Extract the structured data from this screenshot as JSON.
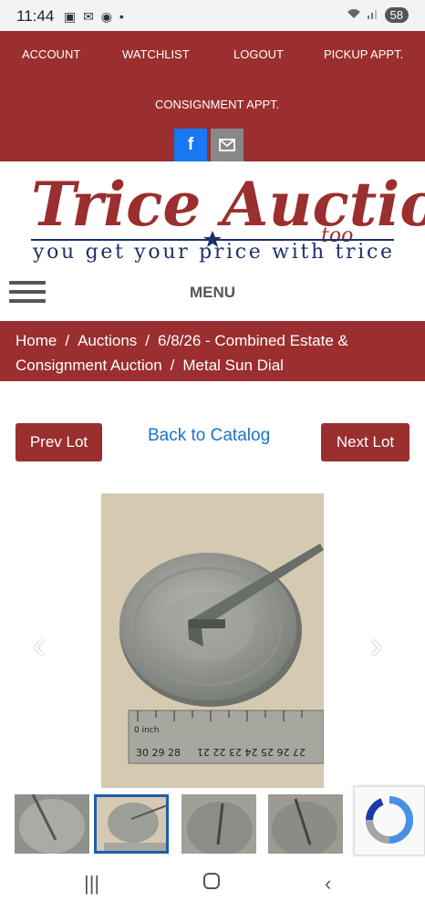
{
  "status": {
    "time": "11:44",
    "battery": "58"
  },
  "nav": {
    "account": "ACCOUNT",
    "watchlist": "WATCHLIST",
    "logout": "LOGOUT",
    "pickup": "PICKUP APPT.",
    "consignment": "CONSIGNMENT APPT."
  },
  "logo": {
    "name": "Trice Auctions",
    "too": "too",
    "tagline": "you get your price with trice"
  },
  "menu": {
    "label": "MENU"
  },
  "breadcrumb": {
    "home": "Home",
    "auctions": "Auctions",
    "sale": "6/8/26 - Combined Estate & Consignment Auction",
    "current": "Metal Sun Dial",
    "separator": "/"
  },
  "lot_nav": {
    "prev": "Prev Lot",
    "back": "Back to Catalog",
    "next": "Next Lot"
  },
  "image": {
    "ruler_label": "0 inch",
    "ruler_numbers": "27 26 25 24 23 22 21",
    "ruler_numbers_bottom": "30 29 28"
  },
  "colors": {
    "brand_red": "#9b2e2e",
    "link_blue": "#1a73c8",
    "facebook": "#1877f2",
    "logo_navy": "#1f2f6b"
  }
}
